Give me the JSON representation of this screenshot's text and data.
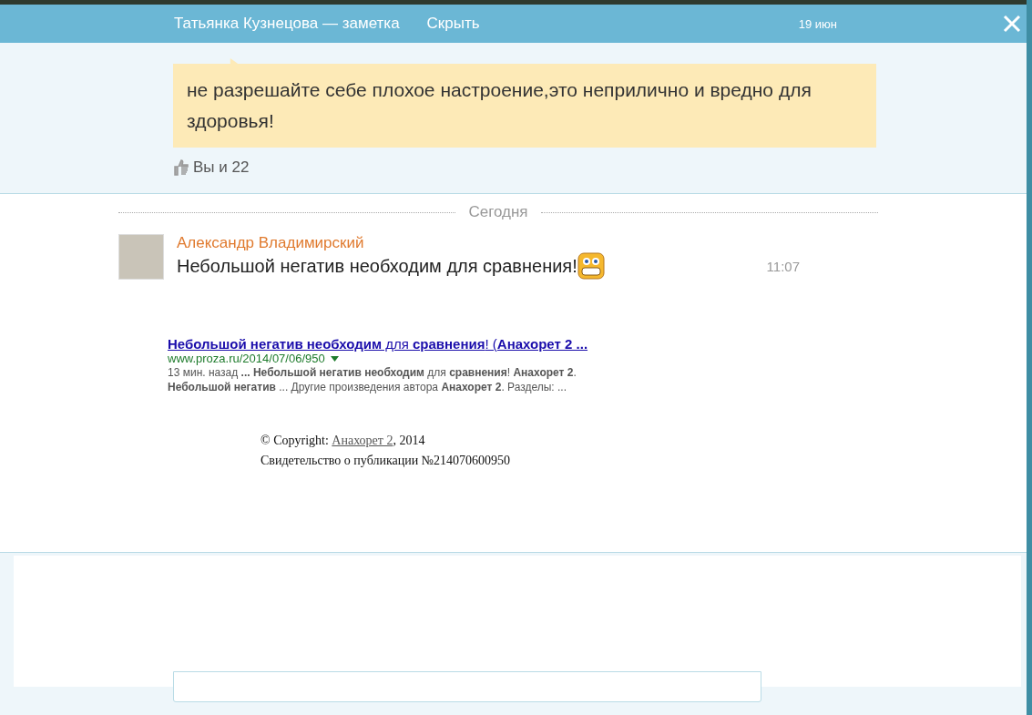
{
  "header": {
    "title": "Татьянка Кузнецова — заметка",
    "hide_link": "Скрыть",
    "date": "19 июн"
  },
  "note": {
    "text": "не разрешайте себе плохое настроение,это неприлично и вредно для здоровья!",
    "likes": "Вы и 22"
  },
  "divider_label": "Сегодня",
  "comment": {
    "author": "Александр Владимирский",
    "text": "Небольшой негатив необходим для сравнения!",
    "time": "11:07"
  },
  "search_result": {
    "title": "**Небольшой негатив необходим** для **сравнения**! (**Анахорет 2 ...**",
    "url": "www.proza.ru/2014/07/06/950",
    "snippet_lines": [
      "13 мин. назад **... Небольшой негатив необходим** для **сравнения**! **Анахорет 2**.",
      "**Небольшой негатив** ... Другие произведения автора **Анахорет 2**. Разделы: ..."
    ]
  },
  "copyright": {
    "prefix": "© Copyright: ",
    "author_link": "Анахорет 2",
    "suffix": ", 2014",
    "certificate": "Свидетельство о публикации №214070600950"
  }
}
